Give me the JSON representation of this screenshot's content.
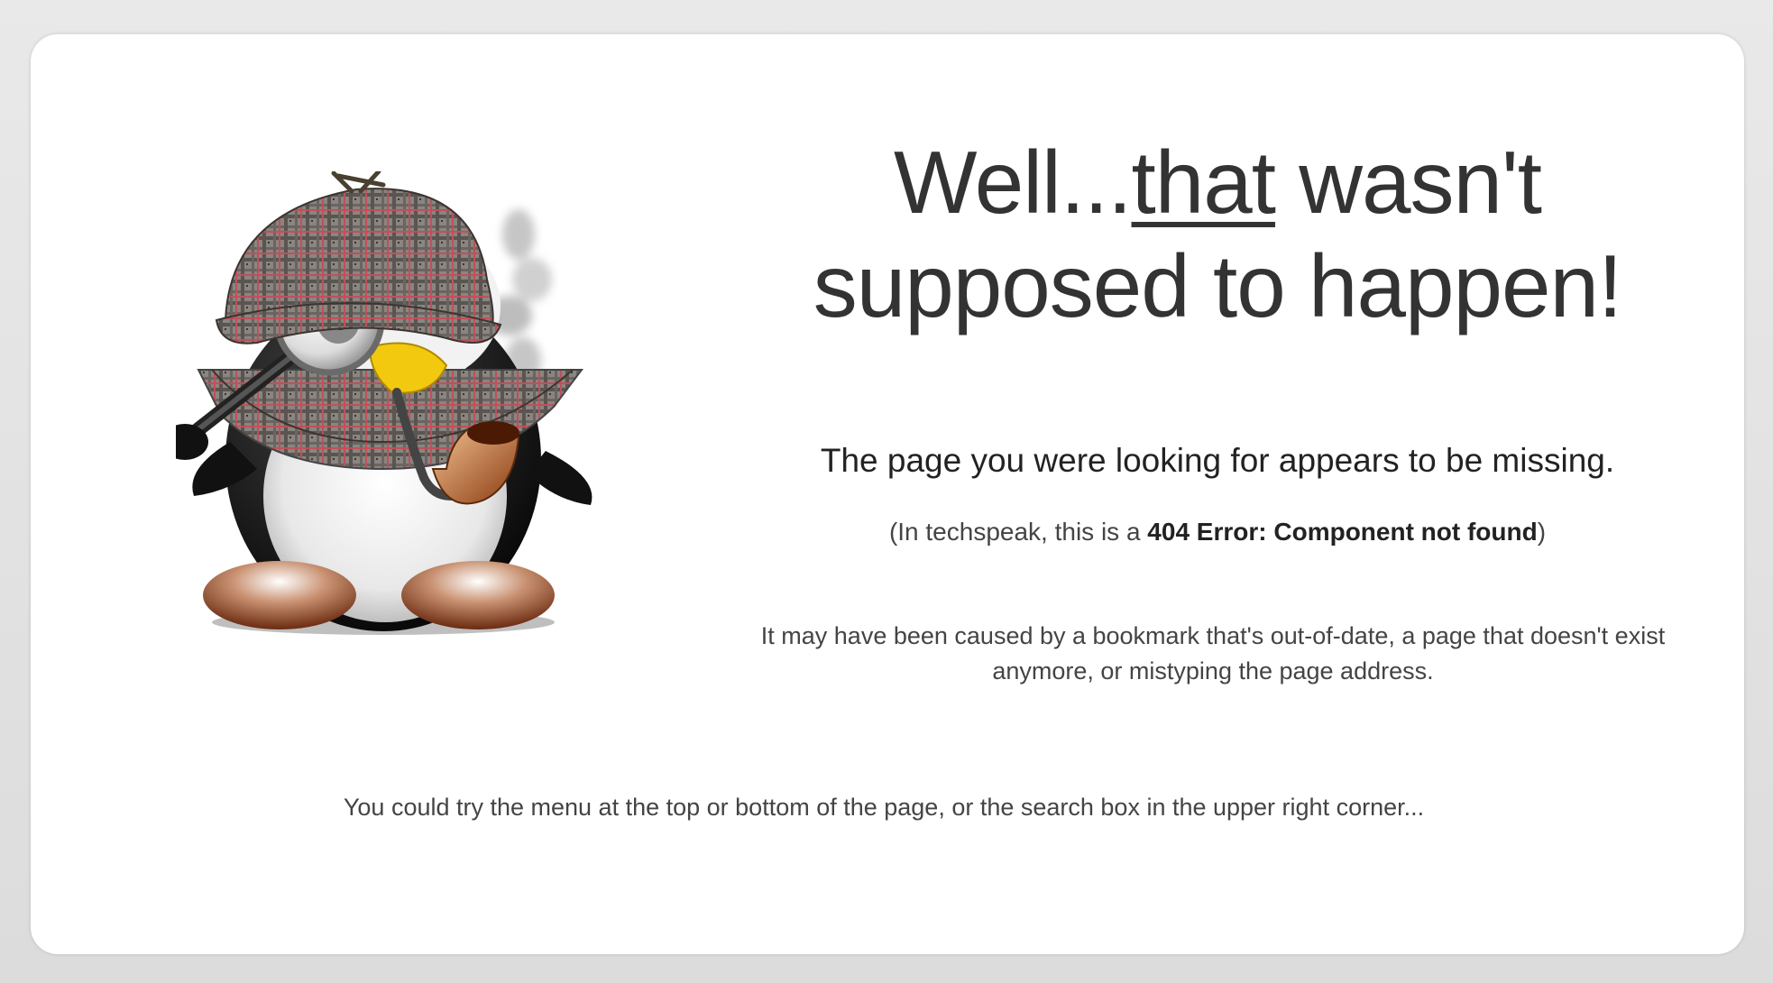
{
  "headline": {
    "part1": "Well...",
    "emphasis": "that",
    "part2": " wasn't supposed to happen!"
  },
  "missing_text": "The page you were looking for appears to be missing.",
  "techspeak": {
    "prefix": "(In techspeak, this is a ",
    "error": "404 Error: Component not found",
    "suffix": ")"
  },
  "cause_text": "It may have been caused by a bookmark that's out-of-date, a page that doesn't exist anymore, or mistyping the page address.",
  "suggestion_text": "You could try the menu at the top or bottom of the page, or the search box in the upper right corner...",
  "illustration": {
    "icon": "detective-penguin-icon"
  },
  "colors": {
    "text": "#333333",
    "card": "#ffffff",
    "frame": "#e6e6e6"
  }
}
